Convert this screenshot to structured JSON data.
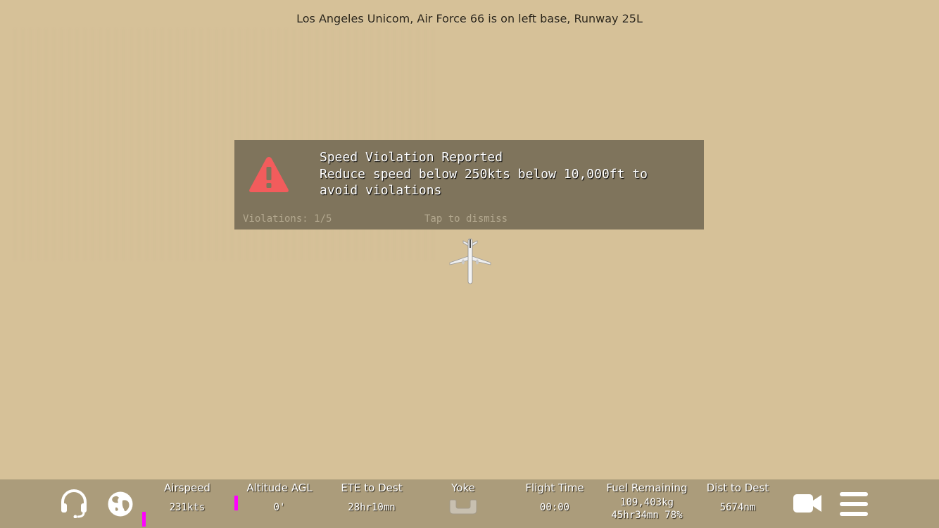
{
  "atc_message": "Los Angeles Unicom, Air Force 66 is on left base, Runway 25L",
  "alert": {
    "title": "Speed Violation Reported",
    "message": "Reduce speed below 250kts below 10,000ft to avoid violations",
    "violations": "Violations: 1/5",
    "dismiss": "Tap to dismiss",
    "icon": "warning-icon",
    "icon_color": "#f25c5c"
  },
  "stats": {
    "airspeed": {
      "label": "Airspeed",
      "value": "231kts"
    },
    "altitude": {
      "label": "Altitude AGL",
      "value": "0'"
    },
    "ete": {
      "label": "ETE to Dest",
      "value": "28hr10mn"
    },
    "yoke": {
      "label": "Yoke"
    },
    "flight_time": {
      "label": "Flight Time",
      "value": "00:00"
    },
    "fuel": {
      "label": "Fuel Remaining",
      "value_line1": "109,403kg",
      "value_line2": "45hr34mn 78%"
    },
    "distance": {
      "label": "Dist to Dest",
      "value": "5674nm"
    }
  },
  "icons": {
    "atc": "headset-icon",
    "map": "globe-icon",
    "yoke": "yoke-icon",
    "camera": "video-camera-icon",
    "menu": "hamburger-menu-icon"
  },
  "colors": {
    "background": "#d6c198",
    "bottom_bar": "#ab9c7b",
    "alert_panel": "#7f745c",
    "indicator": "#ff00ff"
  }
}
